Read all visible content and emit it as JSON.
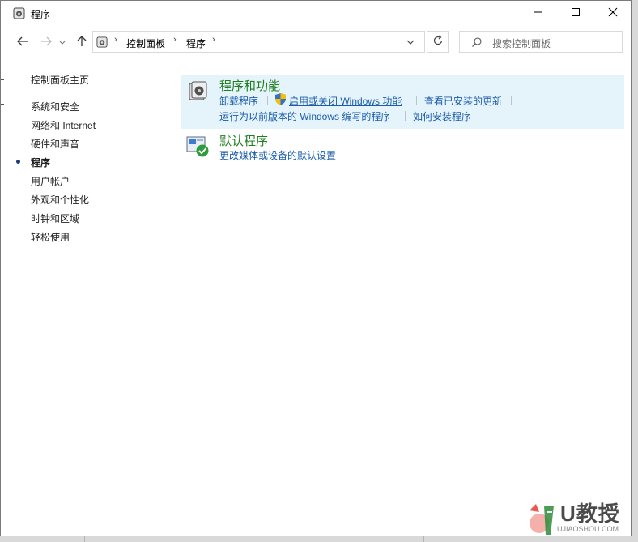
{
  "window": {
    "title": "程序",
    "title_icon": "control-panel-programs-icon"
  },
  "nav": {
    "back_icon": "arrow-left-icon",
    "forward_icon": "arrow-right-icon",
    "recent_icon": "chevron-down-icon",
    "up_icon": "arrow-up-icon"
  },
  "breadcrumb": {
    "items": [
      "控制面板",
      "程序"
    ],
    "separator": "›"
  },
  "search": {
    "placeholder": "搜索控制面板"
  },
  "sidebar": {
    "home": "控制面板主页",
    "items": [
      "系统和安全",
      "网络和 Internet",
      "硬件和声音",
      "程序",
      "用户帐户",
      "外观和个性化",
      "时钟和区域",
      "轻松使用"
    ],
    "active_index": 3
  },
  "categories": [
    {
      "title": "程序和功能",
      "links": [
        "卸载程序",
        "启用或关闭 Windows 功能",
        "查看已安装的更新",
        "运行为以前版本的 Windows 编写的程序",
        "如何安装程序"
      ]
    },
    {
      "title": "默认程序",
      "links": [
        "更改媒体或设备的默认设置"
      ]
    }
  ],
  "colors": {
    "link": "#1a5caa",
    "category_title": "#1f7d1f",
    "highlight": "#e5f3fb"
  },
  "watermark": {
    "text": "U教授",
    "sub": "UJIAOSHOU.COM"
  }
}
